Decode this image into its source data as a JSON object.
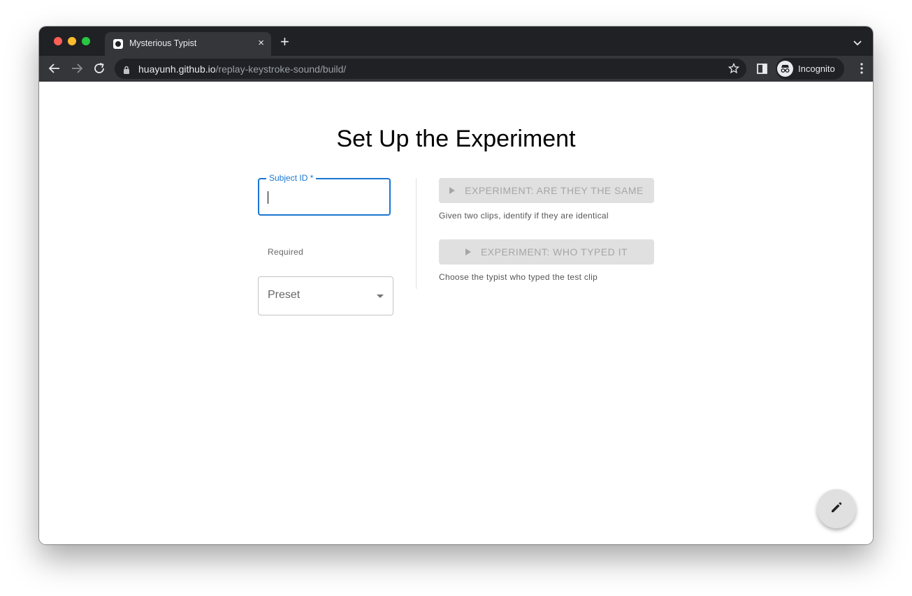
{
  "browser": {
    "tab_title": "Mysterious Typist",
    "tab_close": "×",
    "new_tab": "+",
    "url_host": "huayunh.github.io",
    "url_path": "/replay-keystroke-sound/build/",
    "profile_label": "Incognito"
  },
  "page": {
    "heading": "Set Up the Experiment",
    "subject_field": {
      "label": "Subject ID *",
      "value": "",
      "helper": "Required"
    },
    "preset_select": {
      "label": "Preset"
    },
    "experiments": [
      {
        "label": "EXPERIMENT: ARE THEY THE SAME",
        "description": "Given two clips, identify if they are identical"
      },
      {
        "label": "EXPERIMENT: WHO TYPED IT",
        "description": "Choose the typist who typed the test clip"
      }
    ]
  },
  "colors": {
    "accent": "#1976d2",
    "disabled_bg": "#e0e0e0",
    "disabled_text": "#a6a6a6"
  },
  "icons": [
    "back-arrow-icon",
    "forward-arrow-icon",
    "reload-icon",
    "lock-icon",
    "star-icon",
    "side-panel-icon",
    "incognito-icon",
    "kebab-menu-icon",
    "play-icon",
    "pencil-icon"
  ]
}
